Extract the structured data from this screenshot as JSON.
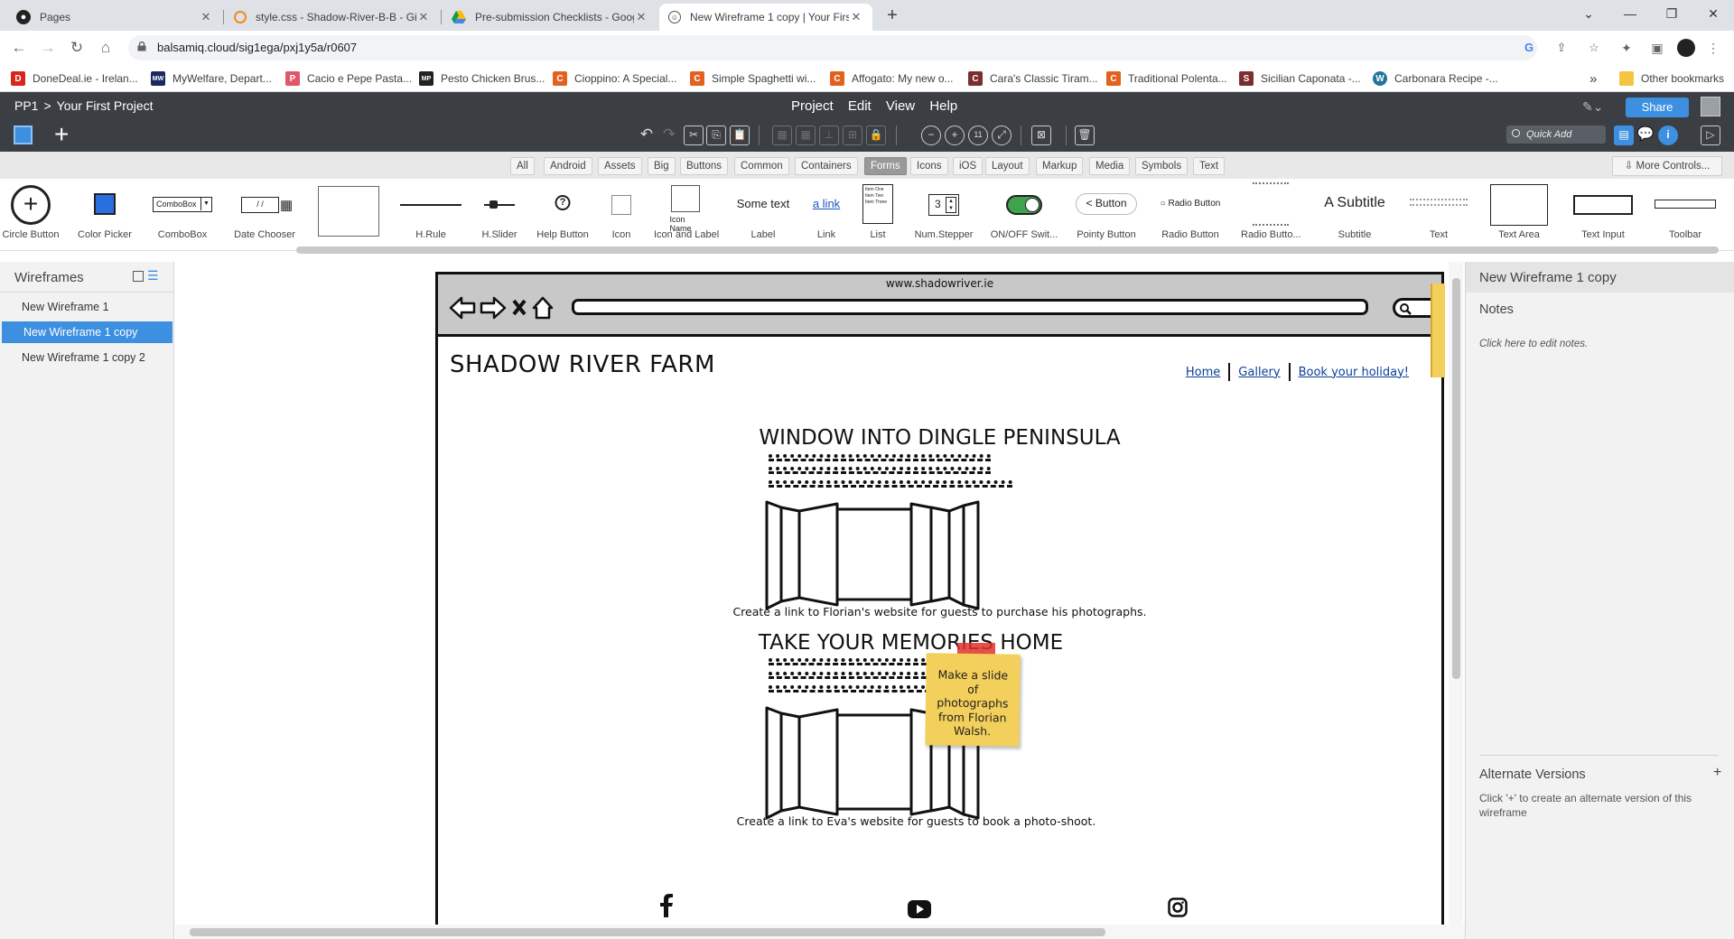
{
  "browser": {
    "tabs": [
      {
        "title": "Pages",
        "close": "✕"
      },
      {
        "title": "style.css - Shadow-River-B-B - Gi",
        "close": "✕"
      },
      {
        "title": "Pre-submission Checklists - Goog",
        "close": "✕"
      },
      {
        "title": "New Wireframe 1 copy | Your Firs",
        "close": "✕"
      }
    ],
    "url": "balsamiq.cloud/sig1ega/pxj1y5a/r0607",
    "bookmarks": [
      {
        "label": "DoneDeal.ie - Irelan...",
        "icon": "D",
        "color": "#d9251d"
      },
      {
        "label": "MyWelfare, Depart...",
        "icon": "MW",
        "color": "#1b2a5e"
      },
      {
        "label": "Cacio e Pepe Pasta...",
        "icon": "P",
        "color": "#e0566a"
      },
      {
        "label": "Pesto Chicken Brus...",
        "icon": "MP",
        "color": "#222"
      },
      {
        "label": "Cioppino: A Special...",
        "icon": "C",
        "color": "#e2611f"
      },
      {
        "label": "Simple Spaghetti wi...",
        "icon": "C",
        "color": "#e2611f"
      },
      {
        "label": "Affogato: My new o...",
        "icon": "C",
        "color": "#e2611f"
      },
      {
        "label": "Cara's Classic Tiram...",
        "icon": "C",
        "color": "#7c2d2d"
      },
      {
        "label": "Traditional Polenta...",
        "icon": "C",
        "color": "#e2611f"
      },
      {
        "label": "Sicilian Caponata -...",
        "icon": "S",
        "color": "#7c2d2d"
      },
      {
        "label": "Carbonara Recipe -...",
        "icon": "W",
        "color": "#21759b"
      }
    ],
    "other_bookmarks": "Other bookmarks",
    "more_bookmarks": "»"
  },
  "app": {
    "breadcrumb_project": "PP1",
    "breadcrumb_sep": ">",
    "breadcrumb_name": "Your First Project",
    "menus": [
      "Project",
      "Edit",
      "View",
      "Help"
    ],
    "share": "Share",
    "quick_add": "Quick Add"
  },
  "library": {
    "tabs": [
      "All",
      "Android",
      "Assets",
      "Big",
      "Buttons",
      "Common",
      "Containers",
      "Forms",
      "Icons",
      "iOS",
      "Layout",
      "Markup",
      "Media",
      "Symbols",
      "Text"
    ],
    "selected_tab": "Forms",
    "more_controls": "More Controls...",
    "items": [
      "Circle Button",
      "Color Picker",
      "ComboBox",
      "Date Chooser",
      "",
      "H.Rule",
      "H.Slider",
      "Help Button",
      "Icon",
      "Icon and Label",
      "Label",
      "Link",
      "List",
      "Num.Stepper",
      "ON/OFF Swit...",
      "Pointy Button",
      "Radio Button",
      "Radio Butto...",
      "Subtitle",
      "Text",
      "Text Area",
      "Text Input",
      "Toolbar"
    ],
    "previews": {
      "combobox": "ComboBox",
      "icon_name": "Icon Name",
      "label": "Some text",
      "link": "a link",
      "stepper": "3",
      "pointy": "Button",
      "radio": "Radio Button",
      "subtitle": "A Subtitle",
      "list": [
        "Item One",
        "Item Two",
        "Item Three"
      ]
    }
  },
  "wireframes": {
    "title": "Wireframes",
    "items": [
      "New Wireframe 1",
      "New Wireframe 1 copy",
      "New Wireframe 1 copy 2"
    ],
    "selected": 1
  },
  "mockup": {
    "url": "www.shadowriver.ie",
    "site_title": "SHADOW RIVER FARM",
    "nav": [
      "Home",
      "Gallery",
      "Book your holiday!"
    ],
    "section1_title": "WINDOW INTO DINGLE PENINSULA",
    "section1_caption": "Create a link to Florian's website for guests to purchase his photographs.",
    "section2_title": "TAKE YOUR MEMORIES HOME",
    "section2_caption": "Create a link to Eva's website for guests to book a photo-shoot.",
    "sticky_note": "Make a slide of photographs from Florian Walsh.",
    "social_icons": [
      "facebook-icon",
      "youtube-icon",
      "instagram-icon"
    ]
  },
  "properties": {
    "title": "New Wireframe 1 copy",
    "notes_label": "Notes",
    "notes_hint": "Click here to edit notes.",
    "alt_label": "Alternate Versions",
    "alt_plus": "+",
    "alt_hint": "Click '+' to create an alternate version of this wireframe"
  }
}
